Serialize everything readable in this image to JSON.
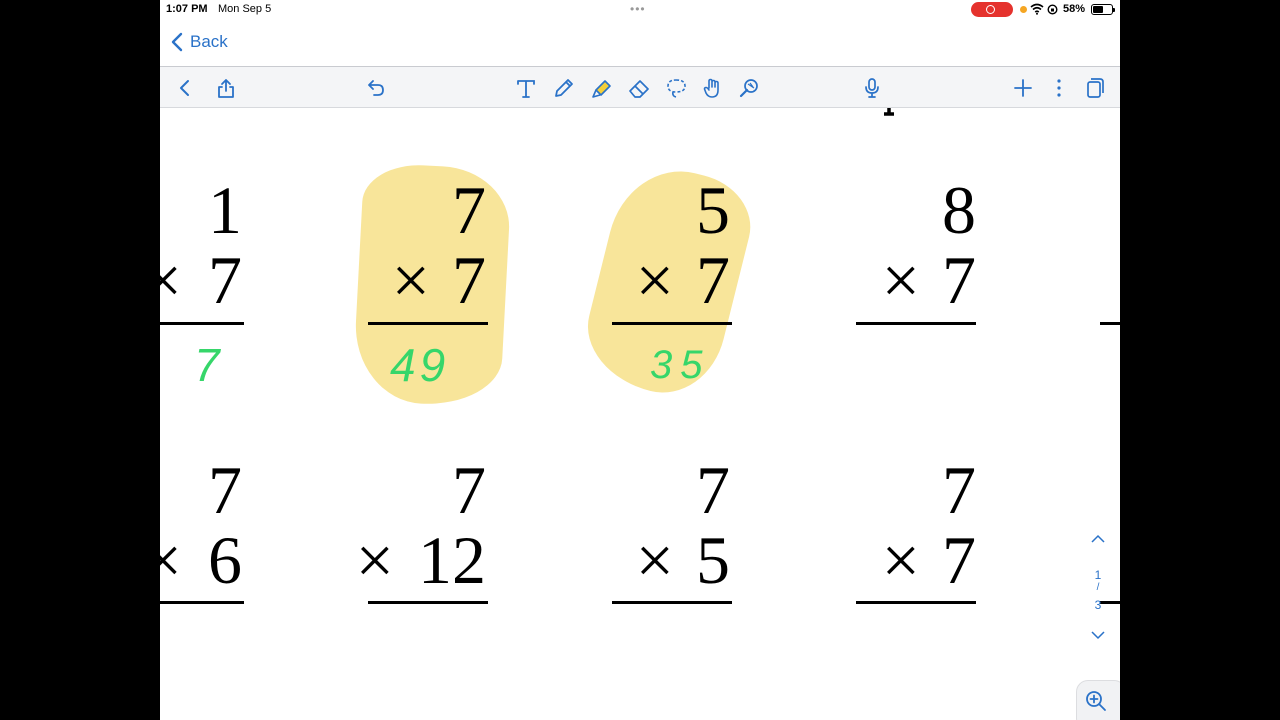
{
  "status_bar": {
    "time": "1:07 PM",
    "date": "Mon Sep 5",
    "battery": "58%",
    "battery_level": 0.58,
    "recording_color": "#e5322d"
  },
  "nav": {
    "back_label": "Back",
    "accent_color": "#2a72c8"
  },
  "toolbar": {
    "tools": [
      "chevron-left-icon",
      "share-icon",
      "undo-icon",
      "text-tool-icon",
      "pen-tool-icon",
      "highlighter-tool-icon",
      "eraser-tool-icon",
      "lasso-tool-icon",
      "hand-tool-icon",
      "pointer-tool-icon",
      "microphone-icon",
      "add-icon",
      "more-icon",
      "pages-icon"
    ],
    "selected_tool": "highlighter-tool-icon",
    "highlighter_color": "#f5cf3a"
  },
  "worksheet": {
    "row1": [
      {
        "top": "1",
        "bottom": "7",
        "answer": "7",
        "highlighted": false
      },
      {
        "top": "7",
        "bottom": "7",
        "answer": "49",
        "highlighted": true
      },
      {
        "top": "5",
        "bottom": "7",
        "answer": "35",
        "highlighted": true
      },
      {
        "top": "8",
        "bottom": "7",
        "answer": "",
        "highlighted": false
      }
    ],
    "row2": [
      {
        "top": "7",
        "bottom": "6"
      },
      {
        "top": "7",
        "bottom": "12"
      },
      {
        "top": "7",
        "bottom": "5"
      },
      {
        "top": "7",
        "bottom": "7"
      }
    ],
    "operator": "×",
    "answer_color": "#36d66a",
    "highlight_color": "#f6dc78"
  },
  "pagination": {
    "current": "1",
    "separator": "/",
    "total": "3"
  }
}
